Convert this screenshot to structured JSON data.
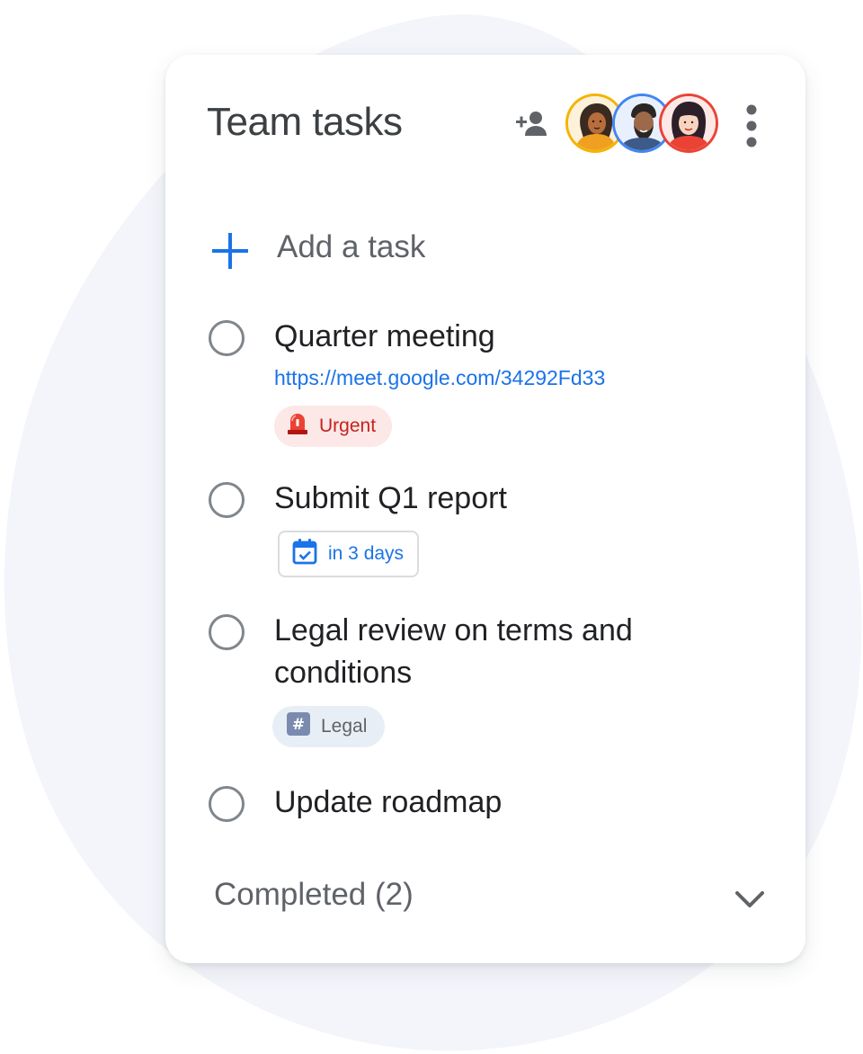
{
  "header": {
    "title": "Team tasks",
    "share_icon": "person-add-icon",
    "more_icon": "more-vert-icon",
    "members": [
      {
        "ring_color": "#f4b400",
        "icon": "avatar-woman-icon"
      },
      {
        "ring_color": "#4285f4",
        "icon": "avatar-man-icon"
      },
      {
        "ring_color": "#ea4335",
        "icon": "avatar-woman-glasses-icon"
      }
    ]
  },
  "add_task": {
    "label": "Add a task",
    "icon": "plus-icon",
    "icon_color": "#1a73e8"
  },
  "tasks": [
    {
      "title": "Quarter meeting",
      "link": "https://meet.google.com/34292Fd33",
      "chip": {
        "label": "Urgent",
        "icon": "siren-icon",
        "color": "#c5221f",
        "bg": "#fce8e6"
      }
    },
    {
      "title": "Submit Q1 report",
      "chip": {
        "label": "in 3 days",
        "icon": "calendar-check-icon",
        "color": "#1a73e8"
      }
    },
    {
      "title": "Legal review on terms and conditions",
      "chip": {
        "label": "Legal",
        "icon": "hashtag-icon",
        "color": "#5f6368",
        "bg": "#e8eef6"
      }
    },
    {
      "title": "Update roadmap"
    }
  ],
  "completed": {
    "label": "Completed (2)",
    "icon": "chevron-down-icon"
  },
  "colors": {
    "accent": "#1a73e8",
    "text_primary": "#202124",
    "text_secondary": "#5f6368",
    "background_blob": "#f1f4fb"
  }
}
